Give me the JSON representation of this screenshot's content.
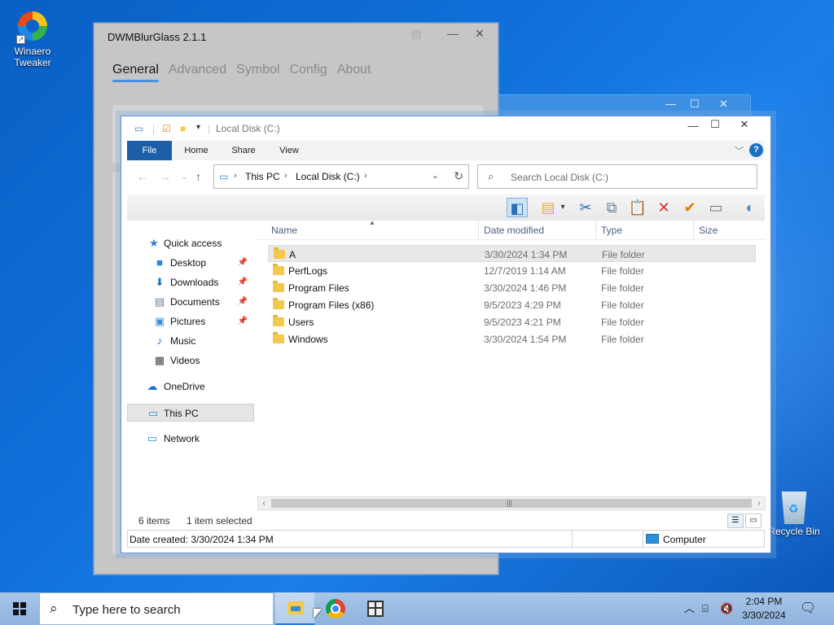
{
  "desktop": {
    "icons": [
      {
        "label": "Winaero Tweaker"
      },
      {
        "label": "Recycle Bin"
      }
    ]
  },
  "dwm": {
    "title": "DWMBlurGlass 2.1.1",
    "tabs": [
      "General",
      "Advanced",
      "Symbol",
      "Config",
      "About"
    ],
    "controls": {
      "minimize": "—",
      "close": "✕"
    }
  },
  "background_window": {
    "controls": {
      "minimize": "—",
      "maximize": "☐",
      "close": "✕"
    }
  },
  "explorer": {
    "title": "Local Disk (C:)",
    "controls": {
      "minimize": "—",
      "maximize": "☐",
      "close": "✕"
    },
    "ribbon_tabs": [
      "File",
      "Home",
      "Share",
      "View"
    ],
    "help": "?",
    "address": {
      "crumbs": [
        "This PC",
        "Local Disk (C:)"
      ]
    },
    "search_placeholder": "Search Local Disk (C:)",
    "nav": [
      {
        "label": "Quick access",
        "icon": "star-icon",
        "pinned": false
      },
      {
        "label": "Desktop",
        "icon": "desktop-icon",
        "pinned": true
      },
      {
        "label": "Downloads",
        "icon": "download-icon",
        "pinned": true
      },
      {
        "label": "Documents",
        "icon": "document-icon",
        "pinned": true
      },
      {
        "label": "Pictures",
        "icon": "picture-icon",
        "pinned": true
      },
      {
        "label": "Music",
        "icon": "music-icon",
        "pinned": false
      },
      {
        "label": "Videos",
        "icon": "video-icon",
        "pinned": false
      },
      {
        "label": "OneDrive",
        "icon": "cloud-icon",
        "pinned": false
      },
      {
        "label": "This PC",
        "icon": "computer-icon",
        "pinned": false,
        "selected": true
      },
      {
        "label": "Network",
        "icon": "network-icon",
        "pinned": false
      }
    ],
    "columns": {
      "name": "Name",
      "date": "Date modified",
      "type": "Type",
      "size": "Size"
    },
    "files": [
      {
        "name": "A",
        "date": "3/30/2024 1:34 PM",
        "type": "File folder",
        "selected": true
      },
      {
        "name": "PerfLogs",
        "date": "12/7/2019 1:14 AM",
        "type": "File folder"
      },
      {
        "name": "Program Files",
        "date": "3/30/2024 1:46 PM",
        "type": "File folder"
      },
      {
        "name": "Program Files (x86)",
        "date": "9/5/2023 4:29 PM",
        "type": "File folder"
      },
      {
        "name": "Users",
        "date": "9/5/2023 4:21 PM",
        "type": "File folder"
      },
      {
        "name": "Windows",
        "date": "3/30/2024 1:54 PM",
        "type": "File folder"
      }
    ],
    "status": {
      "count": "6 items",
      "selection": "1 item selected"
    },
    "details": {
      "created": "Date created: 3/30/2024 1:34 PM",
      "location": "Computer"
    }
  },
  "taskbar": {
    "search_placeholder": "Type here to search",
    "time": "2:04 PM",
    "date": "3/30/2024"
  },
  "colors": {
    "accent": "#1c5fa8",
    "desktop": "#0f6fd8",
    "delete": "#d32f2f",
    "check": "#e07b00"
  }
}
